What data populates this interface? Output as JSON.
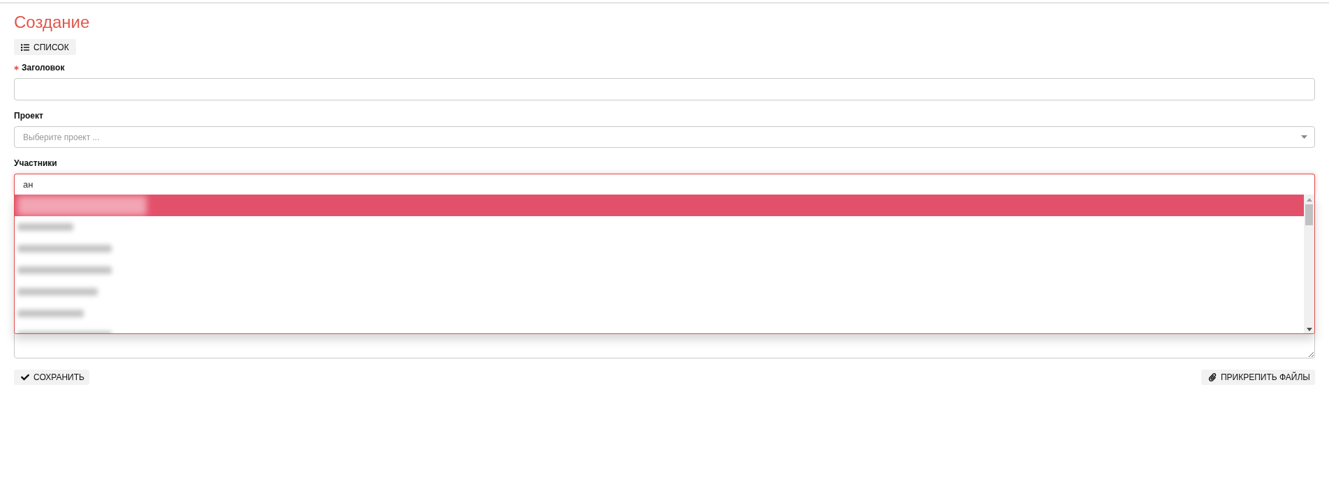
{
  "title": "Создание",
  "list_button": {
    "label": "СПИСОК"
  },
  "fields": [
    {
      "kind": "text",
      "label": "Заголовок",
      "required": true
    },
    {
      "kind": "select",
      "label": "Проект",
      "required": false,
      "placeholder": "Выберите проект ..."
    },
    {
      "kind": "multiselect",
      "label": "Участники",
      "required": false,
      "search": "ан",
      "open": true,
      "options": [
        {
          "selected": true
        },
        {
          "selected": false
        },
        {
          "selected": false
        },
        {
          "selected": false
        },
        {
          "selected": false
        },
        {
          "selected": false
        },
        {
          "selected": false
        }
      ]
    },
    {
      "kind": "textarea"
    }
  ],
  "actions": [
    {
      "kind": "save",
      "label": "СОХРАНИТЬ"
    },
    {
      "kind": "attach",
      "label": "ПРИКРЕПИТЬ ФАЙЛЫ"
    }
  ]
}
